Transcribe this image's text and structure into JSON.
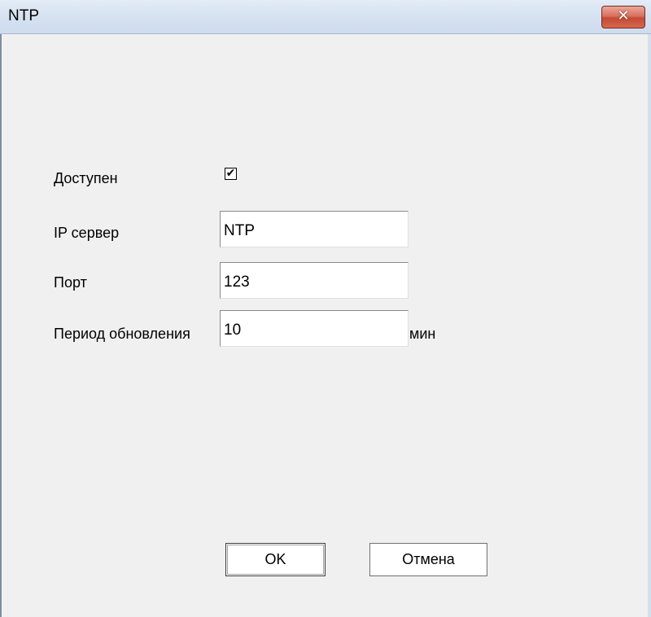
{
  "window": {
    "title": "NTP",
    "close_glyph": "✕"
  },
  "form": {
    "enabled": {
      "label": "Доступен",
      "checked": true,
      "check_glyph": "✔"
    },
    "server": {
      "label": "IP сервер",
      "value": "NTP"
    },
    "port": {
      "label": "Порт",
      "value": "123"
    },
    "period": {
      "label": "Период обновления",
      "value": "10",
      "unit": "мин"
    }
  },
  "buttons": {
    "ok_label": "OK",
    "cancel_label": "Отмена"
  },
  "icons": {
    "close": "close-icon",
    "check": "checkmark-icon"
  },
  "colors": {
    "close_button": "#c44a33",
    "titlebar": "#d3e0f0",
    "dialog_background": "#f0f0f0"
  }
}
